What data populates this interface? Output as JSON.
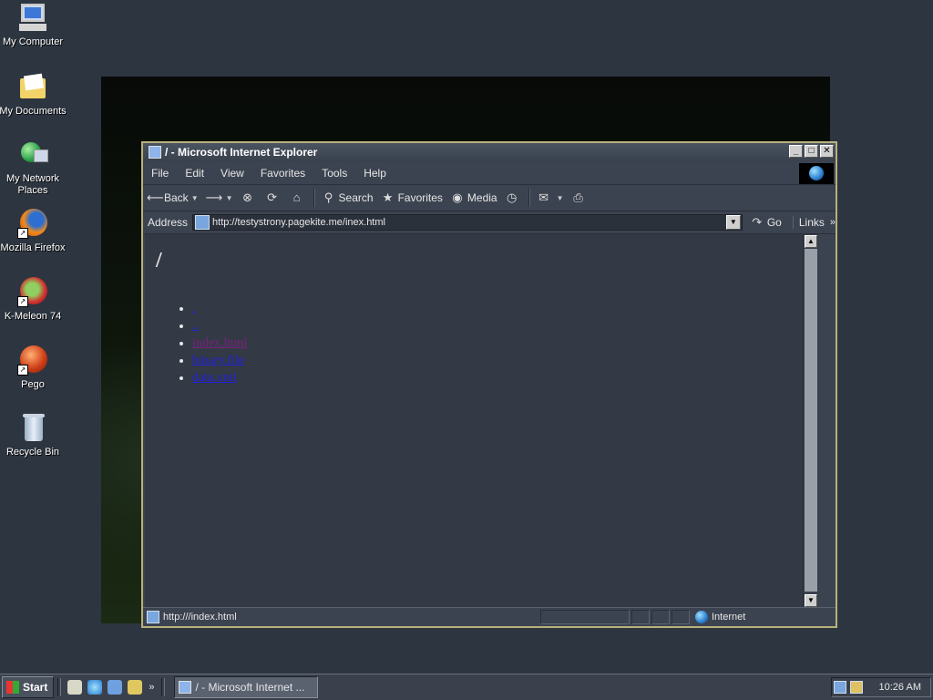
{
  "desktop": {
    "icons": [
      {
        "label": "My Computer"
      },
      {
        "label": "My Documents"
      },
      {
        "label": "My Network Places"
      },
      {
        "label": "Mozilla Firefox"
      },
      {
        "label": "K-Meleon 74"
      },
      {
        "label": "Pego"
      },
      {
        "label": "Recycle Bin"
      }
    ]
  },
  "window": {
    "title": "/ - Microsoft Internet Explorer",
    "menu": [
      "File",
      "Edit",
      "View",
      "Favorites",
      "Tools",
      "Help"
    ],
    "toolbar": {
      "back": "Back",
      "search": "Search",
      "favorites": "Favorites",
      "media": "Media"
    },
    "address": {
      "label": "Address",
      "value": "http://testystrony.pagekite.me/inex.html",
      "go": "Go",
      "links": "Links"
    },
    "status": {
      "text": "http:///index.html",
      "zone": "Internet"
    }
  },
  "page": {
    "heading": "/",
    "links": [
      {
        "text": ".",
        "visited": false
      },
      {
        "text": "..",
        "visited": false
      },
      {
        "text": "index.html",
        "visited": true
      },
      {
        "text": "binary.file",
        "visited": false
      },
      {
        "text": "data.xml",
        "visited": false
      }
    ]
  },
  "taskbar": {
    "start": "Start",
    "task": "/ - Microsoft Internet ...",
    "clock": "10:26 AM"
  }
}
